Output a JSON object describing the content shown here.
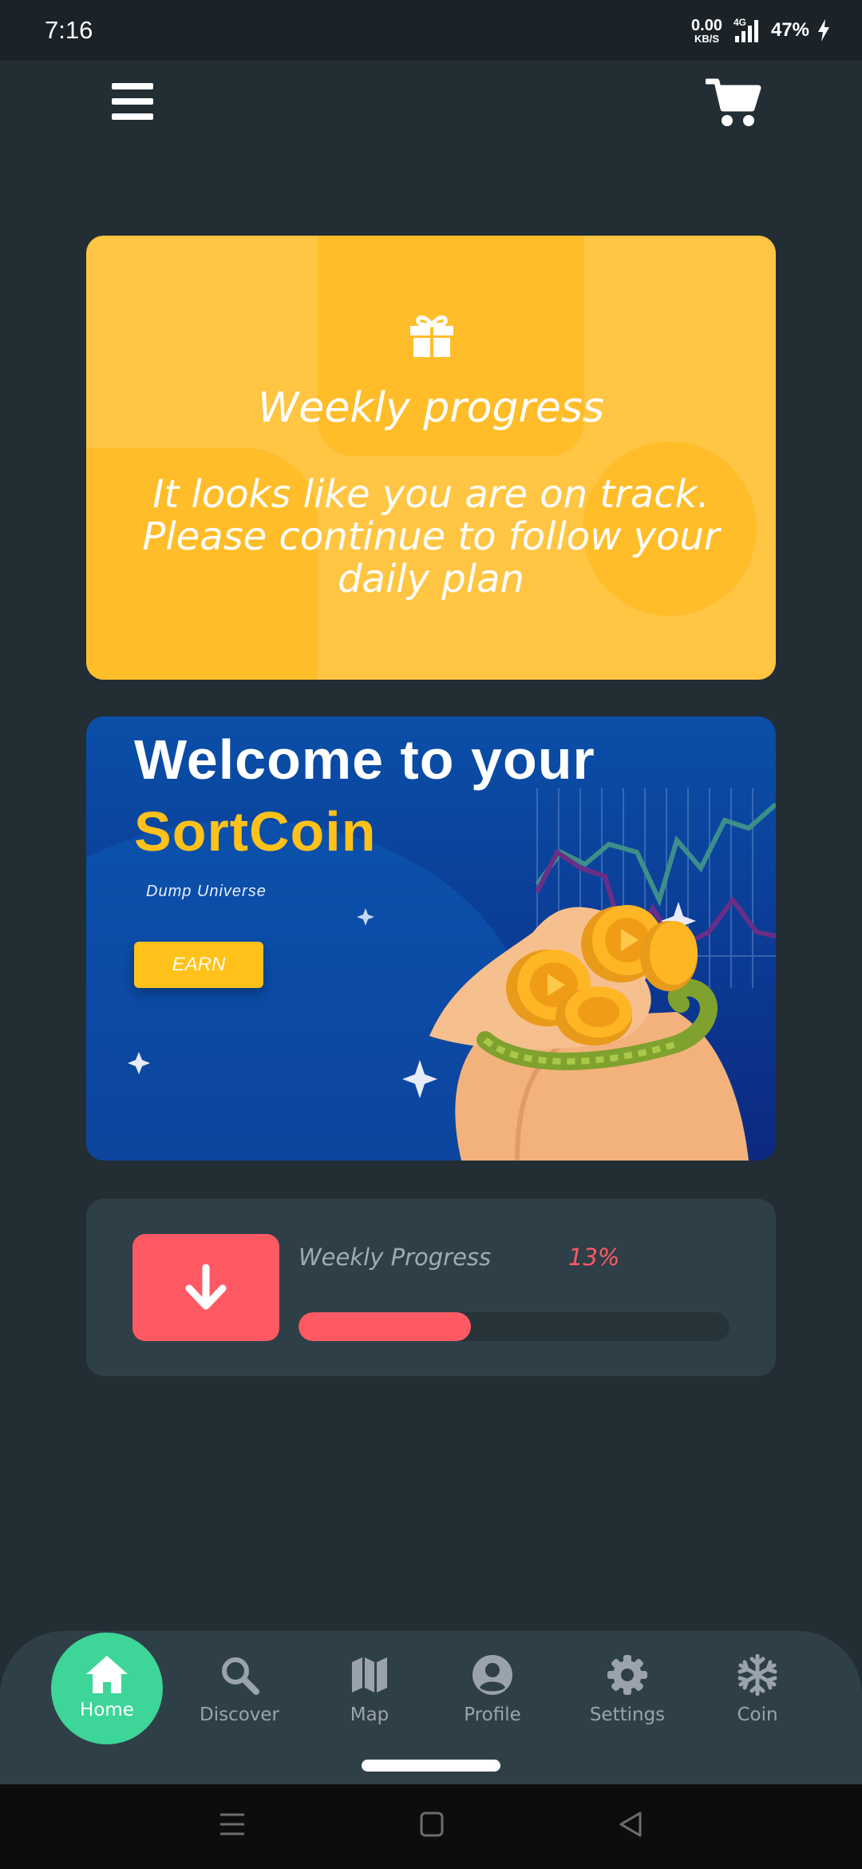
{
  "status_bar": {
    "time": "7:16",
    "net_speed_value": "0.00",
    "net_speed_unit": "KB/S",
    "network_type": "4G",
    "battery": "47%"
  },
  "top_bar": {
    "menu_icon": "hamburger-menu-icon",
    "cart_icon": "shopping-cart-icon"
  },
  "weekly_card": {
    "icon": "gift-icon",
    "title": "Weekly progress",
    "message": "It looks like you are on track. Please continue to follow your daily plan",
    "color": "#ffc543"
  },
  "banner": {
    "title_line1": "Welcome to your",
    "title_line2": "SortCoin",
    "subtitle": "Dump Universe",
    "button_label": "EARN",
    "accent": "#ffc11a"
  },
  "progress": {
    "label": "Weekly Progress",
    "percent_text": "13%",
    "value": 0.4,
    "icon": "arrow-down-icon",
    "color": "#ff5a64"
  },
  "bottom_nav": {
    "active": "Home",
    "items": [
      {
        "label": "Home",
        "icon": "home-icon"
      },
      {
        "label": "Discover",
        "icon": "search-icon"
      },
      {
        "label": "Map",
        "icon": "map-icon"
      },
      {
        "label": "Profile",
        "icon": "user-circle-icon"
      },
      {
        "label": "Settings",
        "icon": "gear-icon"
      },
      {
        "label": "Coin",
        "icon": "snowflake-icon"
      }
    ],
    "active_color": "#3dd598"
  }
}
